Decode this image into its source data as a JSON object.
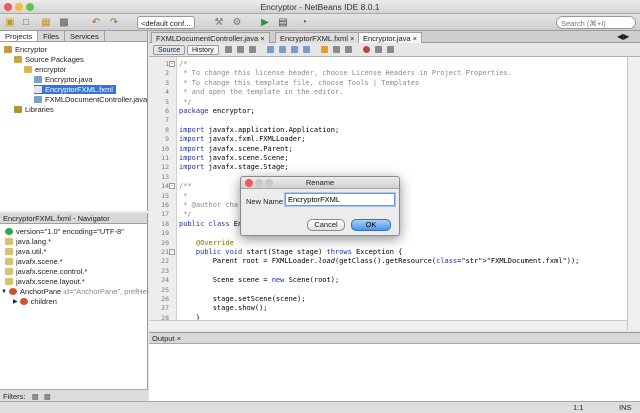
{
  "window": {
    "title": "Encryptor - NetBeans IDE 8.0.1"
  },
  "toolbar": {
    "config_value": "<default conf...",
    "search_placeholder": "Search (⌘+I)"
  },
  "projects": {
    "tabs": [
      "Projects",
      "Files",
      "Services"
    ],
    "tree": [
      {
        "label": "Encryptor"
      },
      {
        "label": "Source Packages"
      },
      {
        "label": "encryptor"
      },
      {
        "label": "Encryptor.java"
      },
      {
        "label": "EncryptorFXML.fxml"
      },
      {
        "label": "FXMLDocumentController.java"
      },
      {
        "label": "Libraries"
      }
    ]
  },
  "navigator": {
    "title": "EncryptorFXML.fxml - Navigator",
    "items": [
      {
        "label": "version=\"1.0\" encoding=\"UTF-8\""
      },
      {
        "label": "java.lang.*"
      },
      {
        "label": "java.util.*"
      },
      {
        "label": "javafx.scene.*"
      },
      {
        "label": "javafx.scene.control.*"
      },
      {
        "label": "javafx.scene.layout.*"
      },
      {
        "label": "AnchorPane",
        "detail": "id=\"AnchorPane\", prefHeight"
      },
      {
        "label": "children"
      }
    ],
    "filters_label": "Filters:"
  },
  "editor_tabs": [
    "FXMLDocumentController.java",
    "EncryptorFXML.fxml",
    "Encryptor.java"
  ],
  "editor_toolbar": {
    "source": "Source",
    "history": "History"
  },
  "code": {
    "line_numbers": [
      "1",
      "2",
      "3",
      "4",
      "5",
      "6",
      "7",
      "8",
      "9",
      "10",
      "11",
      "12",
      "13",
      "14",
      "15",
      "16",
      "17",
      "18",
      "19",
      "20",
      "21",
      "22",
      "23",
      "24",
      "25",
      "26",
      "27",
      "28"
    ],
    "lines": [
      "/*",
      " * To change this license header, choose License Headers in Project Properties.",
      " * To change this template file, choose Tools | Templates",
      " * and open the template in the editor.",
      " */",
      "package encryptor;",
      "",
      "import javafx.application.Application;",
      "import javafx.fxml.FXMLLoader;",
      "import javafx.scene.Parent;",
      "import javafx.scene.Scene;",
      "import javafx.stage.Stage;",
      "",
      "/**",
      " *",
      " * @author cha",
      " */",
      "public class En",
      "",
      "    @Override",
      "    public void start(Stage stage) throws Exception {",
      "        Parent root = FXMLLoader.load(getClass().getResource(\"FXMLDocument.fxml\"));",
      "",
      "        Scene scene = new Scene(root);",
      "",
      "        stage.setScene(scene);",
      "        stage.show();",
      "    }"
    ]
  },
  "output": {
    "title": "Output"
  },
  "status": {
    "position": "1:1",
    "mode": "INS"
  },
  "dialog": {
    "title": "Rename",
    "label": "New Name:",
    "value": "EncryptorFXML",
    "cancel": "Cancel",
    "ok": "OK"
  }
}
